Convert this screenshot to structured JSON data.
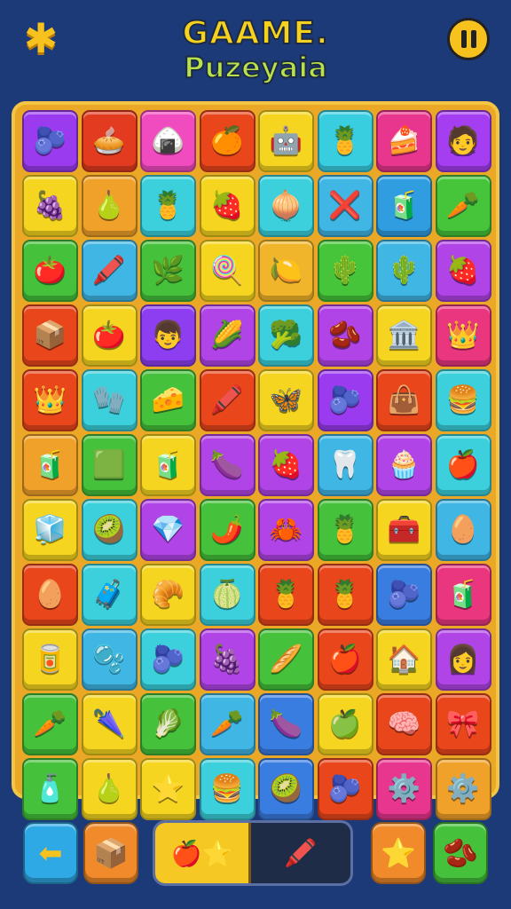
{
  "header": {
    "logo_icon": "puzzle-piece-icon",
    "title_line1": "GAAME.",
    "title_line2": "Puzeyaia",
    "pause_icon": "pause-icon"
  },
  "board": {
    "rows": [
      [
        {
          "bg": "#9b3bef",
          "icon": "🫐"
        },
        {
          "bg": "#e23b1f",
          "icon": "🥧"
        },
        {
          "bg": "#f04bbf",
          "icon": "🍙"
        },
        {
          "bg": "#e9461c",
          "icon": "🍊"
        },
        {
          "bg": "#f5d520",
          "icon": "🤖"
        },
        {
          "bg": "#39cde0",
          "icon": "🍍"
        },
        {
          "bg": "#e8358e",
          "icon": "🍰"
        },
        {
          "bg": "#a53df0",
          "icon": "🧑"
        }
      ],
      [
        {
          "bg": "#f5d520",
          "icon": "🍇"
        },
        {
          "bg": "#f0a12a",
          "icon": "🍐"
        },
        {
          "bg": "#3bd0dc",
          "icon": "🍍"
        },
        {
          "bg": "#f5d520",
          "icon": "🍓"
        },
        {
          "bg": "#3bd0dc",
          "icon": "🧅"
        },
        {
          "bg": "#3fb6e4",
          "icon": "❌"
        },
        {
          "bg": "#2f9de0",
          "icon": "🧃"
        },
        {
          "bg": "#46c43a",
          "icon": "🥕"
        }
      ],
      [
        {
          "bg": "#45c13b",
          "icon": "🍅"
        },
        {
          "bg": "#3fb6e4",
          "icon": "🖍️"
        },
        {
          "bg": "#45c13b",
          "icon": "🌿"
        },
        {
          "bg": "#f5d520",
          "icon": "🍭"
        },
        {
          "bg": "#f0b52a",
          "icon": "🍋"
        },
        {
          "bg": "#46c43a",
          "icon": "🌵"
        },
        {
          "bg": "#3fb6e4",
          "icon": "🌵"
        },
        {
          "bg": "#b144e6",
          "icon": "🍓"
        }
      ],
      [
        {
          "bg": "#e9461c",
          "icon": "📦"
        },
        {
          "bg": "#f5d520",
          "icon": "🍅"
        },
        {
          "bg": "#8c3ef0",
          "icon": "👦"
        },
        {
          "bg": "#b144e6",
          "icon": "🌽"
        },
        {
          "bg": "#3bd0dc",
          "icon": "🥦"
        },
        {
          "bg": "#b144e6",
          "icon": "🫘"
        },
        {
          "bg": "#f5d520",
          "icon": "🏛️"
        },
        {
          "bg": "#e9367f",
          "icon": "👑"
        }
      ],
      [
        {
          "bg": "#e9461c",
          "icon": "👑"
        },
        {
          "bg": "#3bd0dc",
          "icon": "🧤"
        },
        {
          "bg": "#45c13b",
          "icon": "🧀"
        },
        {
          "bg": "#e9461c",
          "icon": "🖍️"
        },
        {
          "bg": "#f5d520",
          "icon": "🦋"
        },
        {
          "bg": "#9b3bef",
          "icon": "🫐"
        },
        {
          "bg": "#e9461c",
          "icon": "👜"
        },
        {
          "bg": "#3bd0dc",
          "icon": "🍔"
        }
      ],
      [
        {
          "bg": "#f0a12a",
          "icon": "🧃"
        },
        {
          "bg": "#45c13b",
          "icon": "🟩"
        },
        {
          "bg": "#f5d520",
          "icon": "🧃"
        },
        {
          "bg": "#b144e6",
          "icon": "🍆"
        },
        {
          "bg": "#b144e6",
          "icon": "🍓"
        },
        {
          "bg": "#3fb6e4",
          "icon": "🦷"
        },
        {
          "bg": "#b144e6",
          "icon": "🧁"
        },
        {
          "bg": "#3bd0dc",
          "icon": "🍎"
        }
      ],
      [
        {
          "bg": "#f5d520",
          "icon": "🧊"
        },
        {
          "bg": "#3bd0dc",
          "icon": "🥝"
        },
        {
          "bg": "#b144e6",
          "icon": "💎"
        },
        {
          "bg": "#45c13b",
          "icon": "🌶️"
        },
        {
          "bg": "#b144e6",
          "icon": "🦀"
        },
        {
          "bg": "#45c13b",
          "icon": "🍍"
        },
        {
          "bg": "#f5d520",
          "icon": "🧰"
        },
        {
          "bg": "#3fb6e4",
          "icon": "🥚"
        }
      ],
      [
        {
          "bg": "#e9461c",
          "icon": "🥚"
        },
        {
          "bg": "#3bd0dc",
          "icon": "🧳"
        },
        {
          "bg": "#f5d520",
          "icon": "🥐"
        },
        {
          "bg": "#3bd0dc",
          "icon": "🍈"
        },
        {
          "bg": "#e9461c",
          "icon": "🍍"
        },
        {
          "bg": "#e9461c",
          "icon": "🍍"
        },
        {
          "bg": "#3a7de0",
          "icon": "🫐"
        },
        {
          "bg": "#e9367f",
          "icon": "🧃"
        }
      ],
      [
        {
          "bg": "#f5d520",
          "icon": "🥫"
        },
        {
          "bg": "#3fb6e4",
          "icon": "🫧"
        },
        {
          "bg": "#3bd0dc",
          "icon": "🫐"
        },
        {
          "bg": "#b144e6",
          "icon": "🍇"
        },
        {
          "bg": "#45c13b",
          "icon": "🥖"
        },
        {
          "bg": "#e9461c",
          "icon": "🍎"
        },
        {
          "bg": "#f5d520",
          "icon": "🏠"
        },
        {
          "bg": "#b144e6",
          "icon": "👩"
        }
      ],
      [
        {
          "bg": "#45c13b",
          "icon": "🥕"
        },
        {
          "bg": "#f5d520",
          "icon": "🌂"
        },
        {
          "bg": "#45c13b",
          "icon": "🥬"
        },
        {
          "bg": "#3fb6e4",
          "icon": "🥕"
        },
        {
          "bg": "#3a7de0",
          "icon": "🍆"
        },
        {
          "bg": "#f5d520",
          "icon": "🍏"
        },
        {
          "bg": "#e9461c",
          "icon": "🧠"
        },
        {
          "bg": "#e9461c",
          "icon": "🎀"
        }
      ],
      [
        {
          "bg": "#45c13b",
          "icon": "🧴"
        },
        {
          "bg": "#f5d520",
          "icon": "🍐"
        },
        {
          "bg": "#f5d520",
          "icon": "⭐"
        },
        {
          "bg": "#3bd0dc",
          "icon": "🍔"
        },
        {
          "bg": "#3a7de0",
          "icon": "🥝"
        },
        {
          "bg": "#e9461c",
          "icon": "🫐"
        },
        {
          "bg": "#e8358e",
          "icon": "⚙️"
        },
        {
          "bg": "#f0a12a",
          "icon": "⚙️"
        }
      ]
    ]
  },
  "toolbar": {
    "back_icon": "arrow-left-icon",
    "back_glyph": "⬅",
    "box_icon": "box-icon",
    "box_glyph": "📦",
    "tray_filled_glyph": "🍎⭐",
    "tray_slot_glyph": "🖍️",
    "star_icon": "star-icon",
    "star_glyph": "⭐",
    "bean_icon": "bean-icon",
    "bean_glyph": "🫘"
  },
  "colors": {
    "background": "#1c3a78",
    "board_frame": "#eaa826",
    "title_yellow": "#f6d21e",
    "title_green": "#b9e14a"
  }
}
